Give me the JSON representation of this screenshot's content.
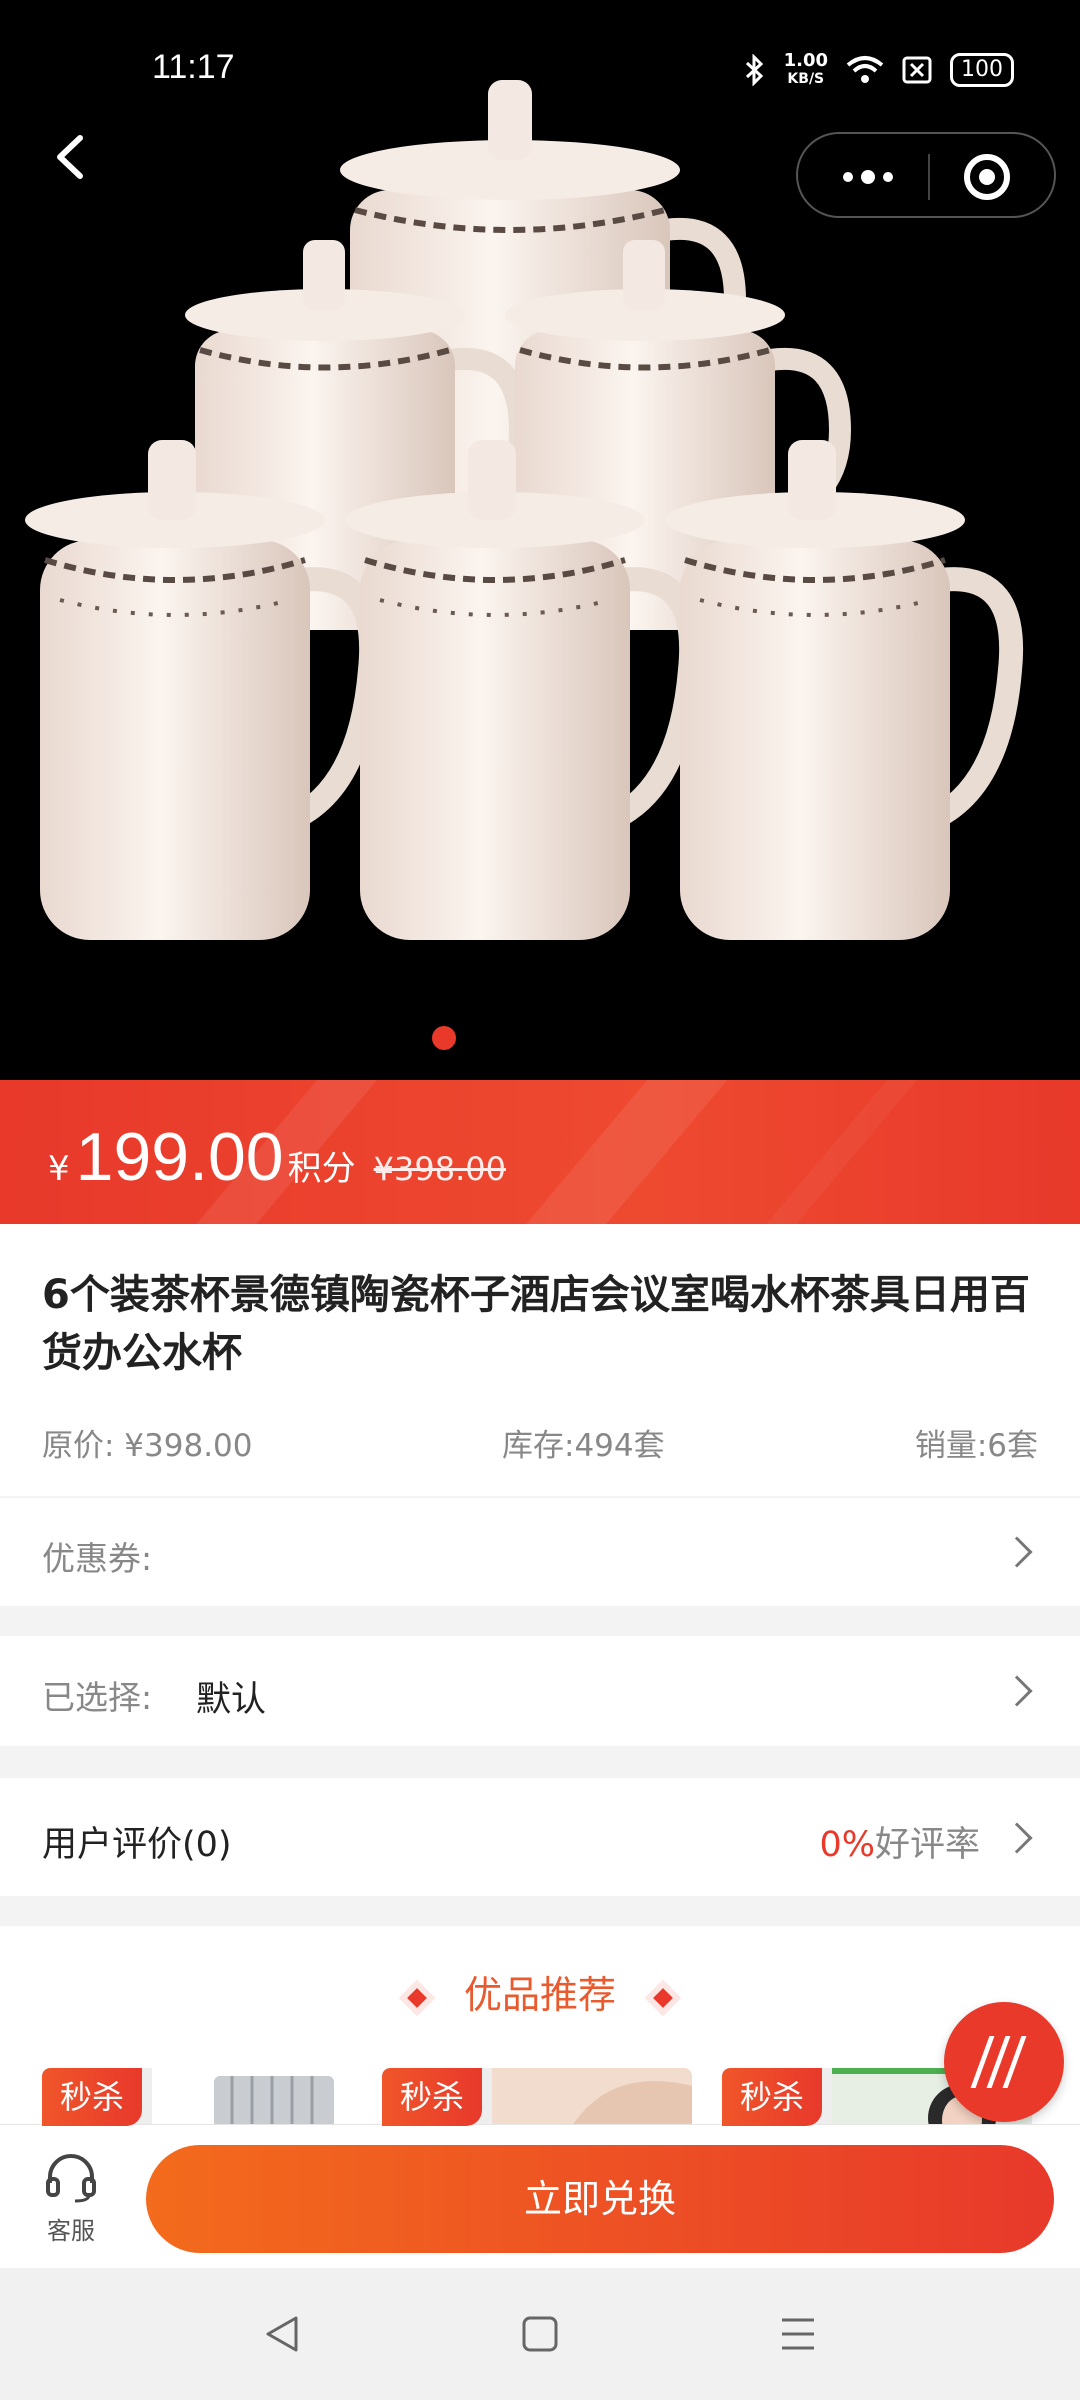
{
  "status_bar": {
    "time": "11:17",
    "net_speed_value": "1.00",
    "net_speed_unit": "KB/S",
    "battery": "100",
    "icons": [
      "bluetooth-icon",
      "wifi-icon",
      "sim-off-icon",
      "battery-icon"
    ]
  },
  "header": {
    "back_icon": "chevron-left-icon",
    "more_icon": "more-dots-icon",
    "close_icon": "target-icon"
  },
  "gallery": {
    "image_subject": "six white porcelain tea cups with lids",
    "current_index": 1,
    "total": 1
  },
  "price": {
    "currency": "¥",
    "value": "199.00",
    "unit": "积分",
    "original": "¥398.00"
  },
  "product": {
    "title": "6个装茶杯景德镇陶瓷杯子酒店会议室喝水杯茶具日用百货办公水杯",
    "original_price": "原价: ¥398.00",
    "stock": "库存:494套",
    "sales": "销量:6套"
  },
  "coupon": {
    "label": "优惠券:"
  },
  "selection": {
    "label": "已选择:",
    "value": "默认"
  },
  "review": {
    "label": "用户评价(0)",
    "rate_pct": "0%",
    "rate_label": "好评率"
  },
  "recommend": {
    "title": "优品推荐",
    "items": [
      {
        "tag": "秒杀"
      },
      {
        "tag": "秒杀"
      },
      {
        "tag": "秒杀"
      }
    ]
  },
  "bottom_bar": {
    "service_label": "客服",
    "exchange_label": "立即兑换"
  },
  "colors": {
    "accent": "#e8392b",
    "accent_orange": "#f36b1c",
    "recommend_title": "#e95a2e"
  }
}
